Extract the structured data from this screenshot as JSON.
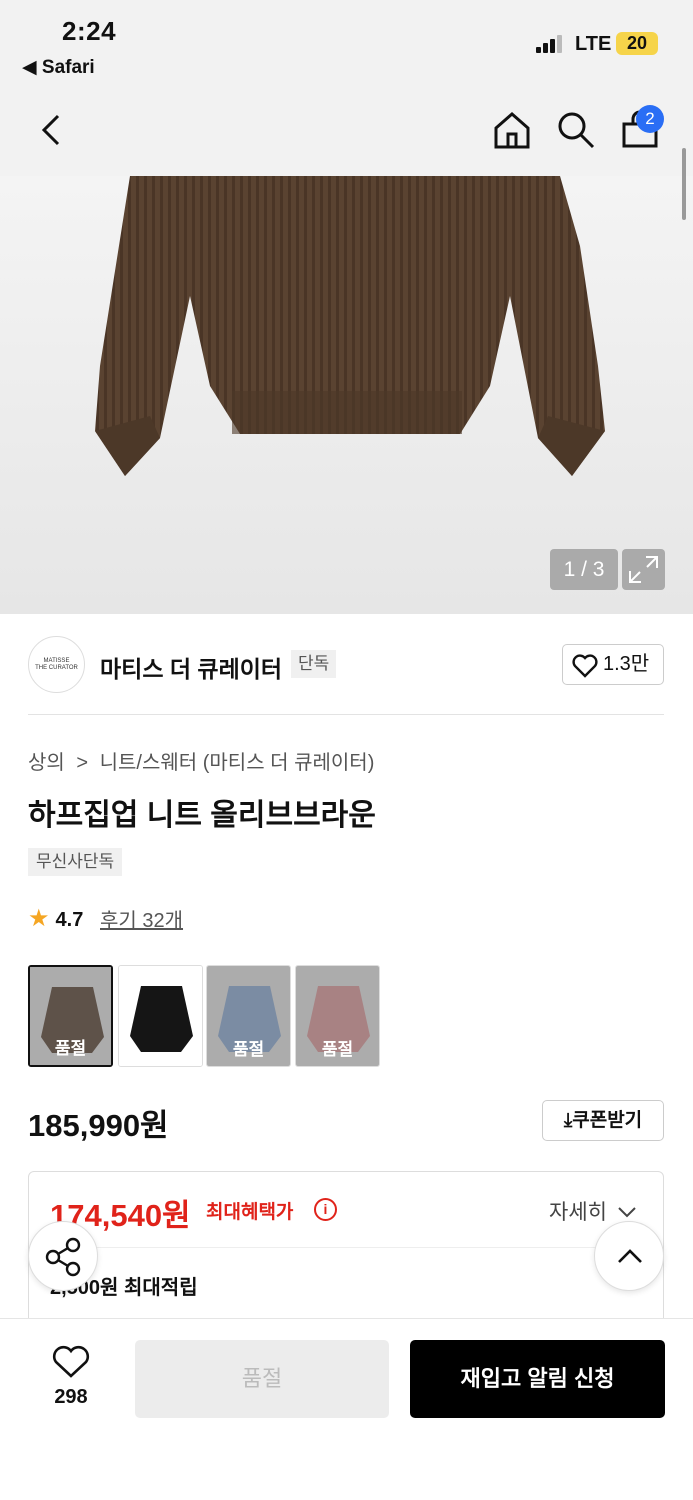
{
  "status_bar": {
    "time": "2:24",
    "back_app": "◀ Safari",
    "network": "LTE",
    "battery": "20"
  },
  "nav": {
    "cart_count": "2"
  },
  "gallery": {
    "counter": "1 / 3"
  },
  "brand": {
    "logo_line1": "MATISSE",
    "logo_line2": "THE CURATOR",
    "name": "마티스 더 큐레이터",
    "badge": "단독",
    "likes": "1.3만"
  },
  "breadcrumb": {
    "category": "상의",
    "separator": ">",
    "subcategory": "니트/스웨터 (마티스 더 큐레이터)"
  },
  "product": {
    "title": "하프집업 니트 올리브브라운",
    "tag": "무신사단독",
    "rating": "4.7",
    "reviews": "후기 32개",
    "price": "185,990원",
    "coupon_label": "쿠폰받기"
  },
  "variants": [
    {
      "color": "#4a3424",
      "sold_out_label": "품절",
      "selected": true
    },
    {
      "color": "#151515",
      "sold_out_label": "",
      "selected": false
    },
    {
      "color": "#7f9dc6",
      "sold_out_label": "품절",
      "selected": false
    },
    {
      "color": "#d08a8c",
      "sold_out_label": "품절",
      "selected": false
    }
  ],
  "benefit": {
    "sale_price": "174,540원",
    "max_benefit_label": "최대혜택가",
    "detail_label": "자세히",
    "points": "2,500원 최대적립"
  },
  "bottom": {
    "wish_count": "298",
    "sold_out": "품절",
    "restock": "재입고 알림 신청"
  },
  "colors": {
    "accent_red": "#e0231a",
    "badge_blue": "#2a6ef5"
  }
}
